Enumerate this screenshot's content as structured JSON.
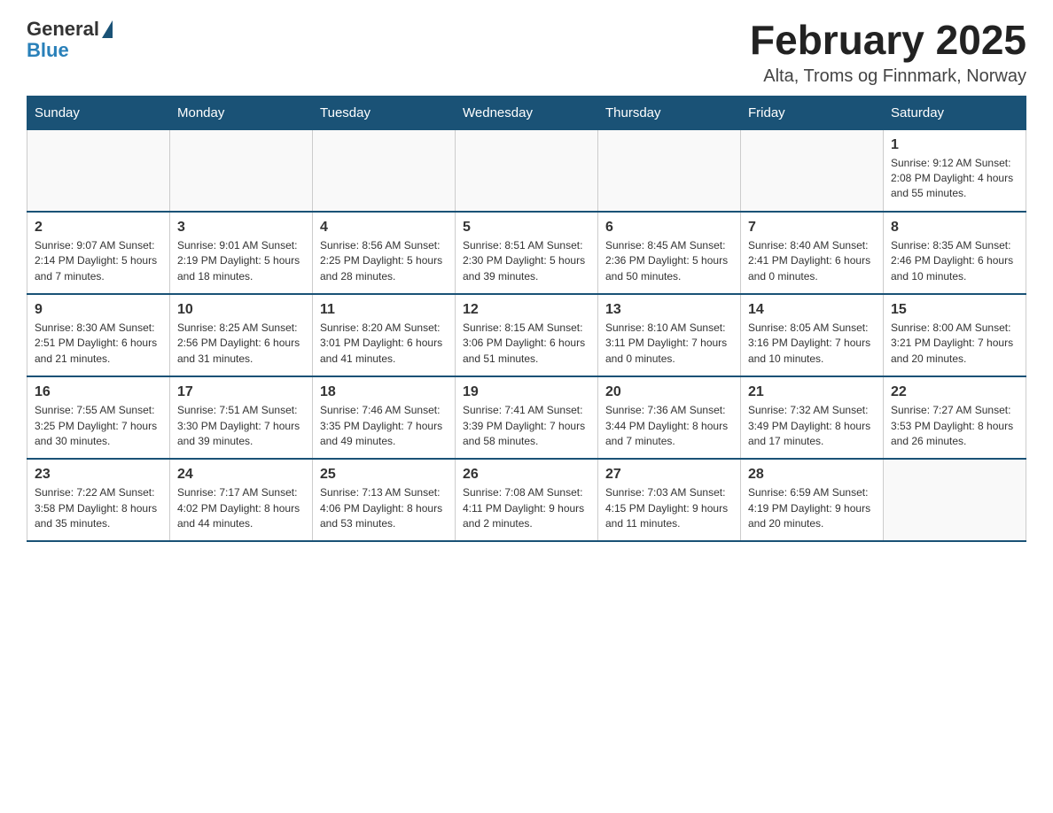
{
  "logo": {
    "general": "General",
    "blue": "Blue"
  },
  "title": "February 2025",
  "subtitle": "Alta, Troms og Finnmark, Norway",
  "weekdays": [
    "Sunday",
    "Monday",
    "Tuesday",
    "Wednesday",
    "Thursday",
    "Friday",
    "Saturday"
  ],
  "weeks": [
    [
      {
        "day": "",
        "info": ""
      },
      {
        "day": "",
        "info": ""
      },
      {
        "day": "",
        "info": ""
      },
      {
        "day": "",
        "info": ""
      },
      {
        "day": "",
        "info": ""
      },
      {
        "day": "",
        "info": ""
      },
      {
        "day": "1",
        "info": "Sunrise: 9:12 AM\nSunset: 2:08 PM\nDaylight: 4 hours\nand 55 minutes."
      }
    ],
    [
      {
        "day": "2",
        "info": "Sunrise: 9:07 AM\nSunset: 2:14 PM\nDaylight: 5 hours\nand 7 minutes."
      },
      {
        "day": "3",
        "info": "Sunrise: 9:01 AM\nSunset: 2:19 PM\nDaylight: 5 hours\nand 18 minutes."
      },
      {
        "day": "4",
        "info": "Sunrise: 8:56 AM\nSunset: 2:25 PM\nDaylight: 5 hours\nand 28 minutes."
      },
      {
        "day": "5",
        "info": "Sunrise: 8:51 AM\nSunset: 2:30 PM\nDaylight: 5 hours\nand 39 minutes."
      },
      {
        "day": "6",
        "info": "Sunrise: 8:45 AM\nSunset: 2:36 PM\nDaylight: 5 hours\nand 50 minutes."
      },
      {
        "day": "7",
        "info": "Sunrise: 8:40 AM\nSunset: 2:41 PM\nDaylight: 6 hours\nand 0 minutes."
      },
      {
        "day": "8",
        "info": "Sunrise: 8:35 AM\nSunset: 2:46 PM\nDaylight: 6 hours\nand 10 minutes."
      }
    ],
    [
      {
        "day": "9",
        "info": "Sunrise: 8:30 AM\nSunset: 2:51 PM\nDaylight: 6 hours\nand 21 minutes."
      },
      {
        "day": "10",
        "info": "Sunrise: 8:25 AM\nSunset: 2:56 PM\nDaylight: 6 hours\nand 31 minutes."
      },
      {
        "day": "11",
        "info": "Sunrise: 8:20 AM\nSunset: 3:01 PM\nDaylight: 6 hours\nand 41 minutes."
      },
      {
        "day": "12",
        "info": "Sunrise: 8:15 AM\nSunset: 3:06 PM\nDaylight: 6 hours\nand 51 minutes."
      },
      {
        "day": "13",
        "info": "Sunrise: 8:10 AM\nSunset: 3:11 PM\nDaylight: 7 hours\nand 0 minutes."
      },
      {
        "day": "14",
        "info": "Sunrise: 8:05 AM\nSunset: 3:16 PM\nDaylight: 7 hours\nand 10 minutes."
      },
      {
        "day": "15",
        "info": "Sunrise: 8:00 AM\nSunset: 3:21 PM\nDaylight: 7 hours\nand 20 minutes."
      }
    ],
    [
      {
        "day": "16",
        "info": "Sunrise: 7:55 AM\nSunset: 3:25 PM\nDaylight: 7 hours\nand 30 minutes."
      },
      {
        "day": "17",
        "info": "Sunrise: 7:51 AM\nSunset: 3:30 PM\nDaylight: 7 hours\nand 39 minutes."
      },
      {
        "day": "18",
        "info": "Sunrise: 7:46 AM\nSunset: 3:35 PM\nDaylight: 7 hours\nand 49 minutes."
      },
      {
        "day": "19",
        "info": "Sunrise: 7:41 AM\nSunset: 3:39 PM\nDaylight: 7 hours\nand 58 minutes."
      },
      {
        "day": "20",
        "info": "Sunrise: 7:36 AM\nSunset: 3:44 PM\nDaylight: 8 hours\nand 7 minutes."
      },
      {
        "day": "21",
        "info": "Sunrise: 7:32 AM\nSunset: 3:49 PM\nDaylight: 8 hours\nand 17 minutes."
      },
      {
        "day": "22",
        "info": "Sunrise: 7:27 AM\nSunset: 3:53 PM\nDaylight: 8 hours\nand 26 minutes."
      }
    ],
    [
      {
        "day": "23",
        "info": "Sunrise: 7:22 AM\nSunset: 3:58 PM\nDaylight: 8 hours\nand 35 minutes."
      },
      {
        "day": "24",
        "info": "Sunrise: 7:17 AM\nSunset: 4:02 PM\nDaylight: 8 hours\nand 44 minutes."
      },
      {
        "day": "25",
        "info": "Sunrise: 7:13 AM\nSunset: 4:06 PM\nDaylight: 8 hours\nand 53 minutes."
      },
      {
        "day": "26",
        "info": "Sunrise: 7:08 AM\nSunset: 4:11 PM\nDaylight: 9 hours\nand 2 minutes."
      },
      {
        "day": "27",
        "info": "Sunrise: 7:03 AM\nSunset: 4:15 PM\nDaylight: 9 hours\nand 11 minutes."
      },
      {
        "day": "28",
        "info": "Sunrise: 6:59 AM\nSunset: 4:19 PM\nDaylight: 9 hours\nand 20 minutes."
      },
      {
        "day": "",
        "info": ""
      }
    ]
  ]
}
